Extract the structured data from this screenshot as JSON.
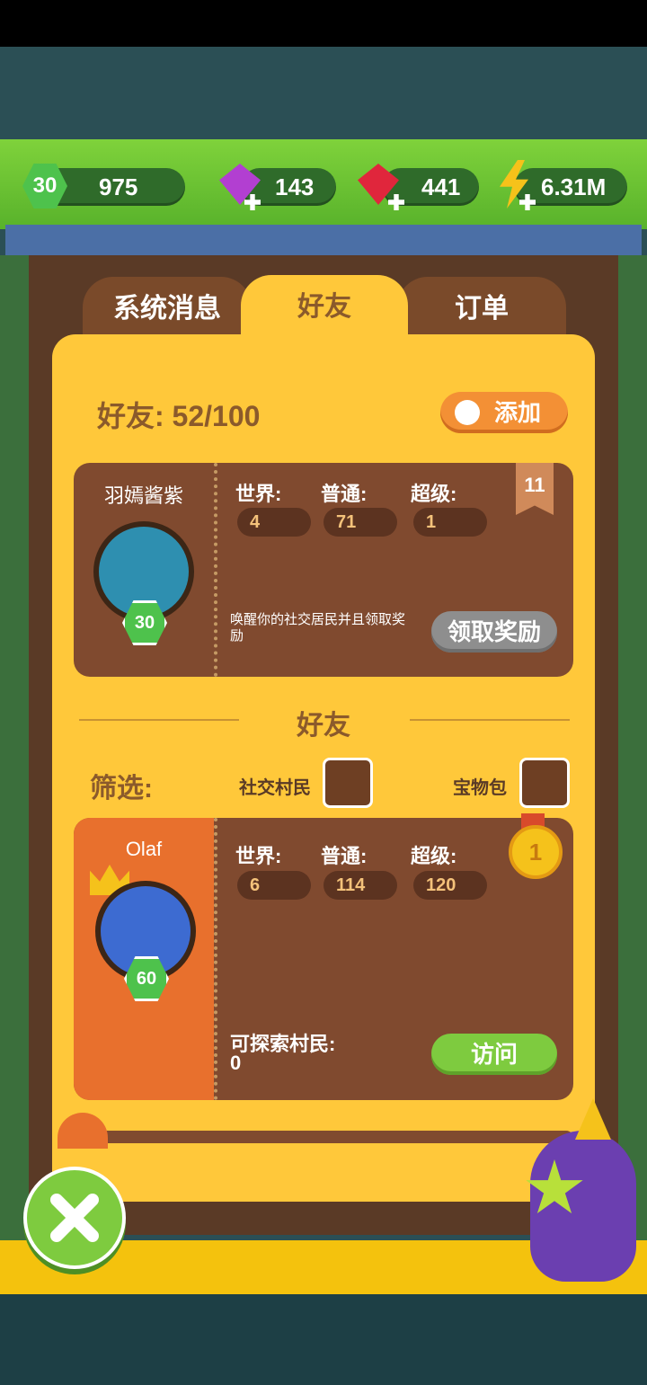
{
  "resources": {
    "level": "30",
    "coins": "975",
    "gems_purple": "143",
    "gems_red": "441",
    "energy": "6.31M"
  },
  "tabs": [
    {
      "label": "系统消息",
      "active": false
    },
    {
      "label": "好友",
      "active": true
    },
    {
      "label": "订单",
      "active": false
    }
  ],
  "friends_header": {
    "label": "好友: 52/100",
    "add_button": "添加"
  },
  "featured_friend": {
    "name": "羽嫣酱紫",
    "level": "30",
    "badge": "11",
    "stats": {
      "world_label": "世界:",
      "world_value": "4",
      "normal_label": "普通:",
      "normal_value": "71",
      "super_label": "超级:",
      "super_value": "1"
    },
    "message": "唤醒你的社交居民并且领取奖励",
    "claim_button": "领取奖励"
  },
  "section_title": "好友",
  "filter": {
    "label": "筛选:",
    "option1": "社交村民",
    "option2": "宝物包"
  },
  "friend_card": {
    "name": "Olaf",
    "level": "60",
    "medal": "1",
    "stats": {
      "world_label": "世界:",
      "world_value": "6",
      "normal_label": "普通:",
      "normal_value": "114",
      "super_label": "超级:",
      "super_value": "120"
    },
    "explorable_label": "可探索村民:",
    "explorable_value": "0",
    "visit_button": "访问"
  },
  "colors": {
    "panel": "#ffc83a",
    "card": "#804a2f",
    "accent_green": "#7ecb3f",
    "accent_orange": "#f39035"
  }
}
